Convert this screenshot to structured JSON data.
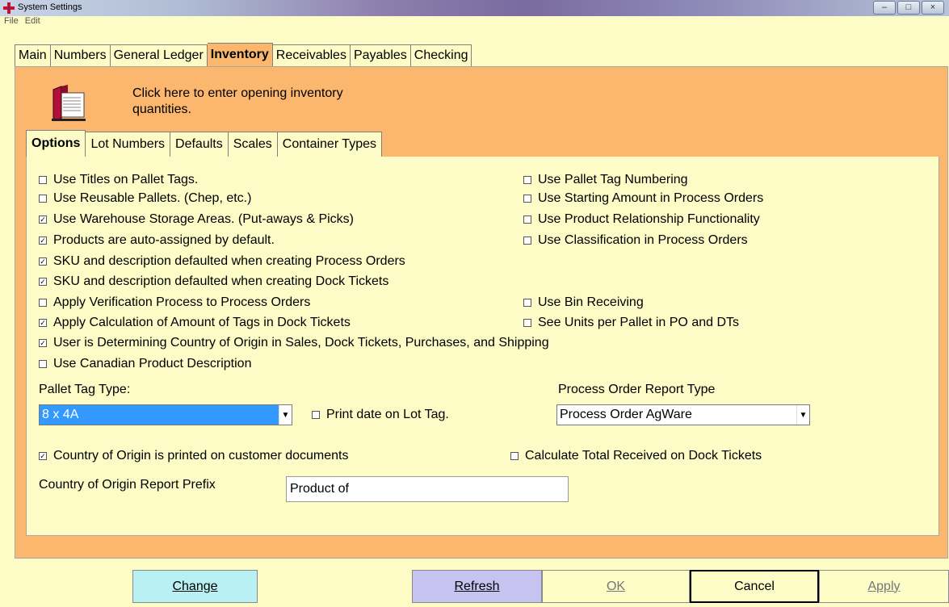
{
  "window": {
    "title": "System Settings"
  },
  "menu": {
    "file": "File",
    "edit": "Edit"
  },
  "main_tabs": [
    {
      "label": "Main",
      "active": false
    },
    {
      "label": "Numbers",
      "active": false
    },
    {
      "label": "General Ledger",
      "active": false
    },
    {
      "label": "Inventory",
      "active": true
    },
    {
      "label": "Receivables",
      "active": false
    },
    {
      "label": "Payables",
      "active": false
    },
    {
      "label": "Checking",
      "active": false
    }
  ],
  "inventory": {
    "hint_line1": "Click here to enter opening inventory",
    "hint_line2": "quantities."
  },
  "sub_tabs": [
    {
      "label": "Options",
      "active": true
    },
    {
      "label": "Lot Numbers",
      "active": false
    },
    {
      "label": "Defaults",
      "active": false
    },
    {
      "label": "Scales",
      "active": false
    },
    {
      "label": "Container Types",
      "active": false
    }
  ],
  "options": {
    "left": [
      {
        "label": "Use Titles on Pallet Tags.",
        "checked": false
      },
      {
        "label": "Use Reusable Pallets. (Chep, etc.)",
        "checked": false
      },
      {
        "label": "Use Warehouse Storage Areas. (Put-aways & Picks)",
        "checked": true
      },
      {
        "label": "Products are auto-assigned by default.",
        "checked": true
      },
      {
        "label": "SKU and description defaulted when creating Process Orders",
        "checked": true
      },
      {
        "label": "SKU and description defaulted when creating Dock Tickets",
        "checked": true
      },
      {
        "label": "Apply Verification Process to Process Orders",
        "checked": false
      },
      {
        "label": "Apply Calculation of Amount of Tags in Dock Tickets",
        "checked": true
      },
      {
        "label": "User is Determining Country of Origin in Sales, Dock Tickets, Purchases, and Shipping",
        "checked": true
      },
      {
        "label": "Use Canadian Product Description",
        "checked": false
      }
    ],
    "right": [
      {
        "label": "Use Pallet Tag Numbering",
        "checked": false
      },
      {
        "label": "Use Starting Amount in Process Orders",
        "checked": false
      },
      {
        "label": "Use Product Relationship Functionality",
        "checked": false
      },
      {
        "label": "Use Classification in Process Orders",
        "checked": false
      },
      {
        "label": "Use Bin Receiving",
        "checked": false
      },
      {
        "label": "See Units per Pallet in PO and DTs",
        "checked": false
      }
    ],
    "pallet_tag_type_label": "Pallet Tag Type:",
    "pallet_tag_type_value": "8 x 4A",
    "print_date_label": "Print date on Lot Tag.",
    "print_date_checked": false,
    "process_order_report_label": "Process Order Report Type",
    "process_order_report_value": "Process Order AgWare",
    "country_printed_label": "Country of Origin is printed on customer documents",
    "country_printed_checked": true,
    "calc_total_label": "Calculate Total Received on Dock Tickets",
    "calc_total_checked": false,
    "prefix_label": "Country of Origin Report Prefix",
    "prefix_value": "Product of"
  },
  "buttons": {
    "change": "Change",
    "refresh": "Refresh",
    "ok": "OK",
    "cancel": "Cancel",
    "apply": "Apply"
  },
  "colors": {
    "background": "#fdfbc6",
    "panel": "#fcb76f",
    "selection": "#3399ff",
    "change_button": "#b8f0f4",
    "refresh_button": "#c6c3f0"
  },
  "icons": {
    "app": "plus-cross-icon",
    "inventory_book": "book-icon"
  }
}
